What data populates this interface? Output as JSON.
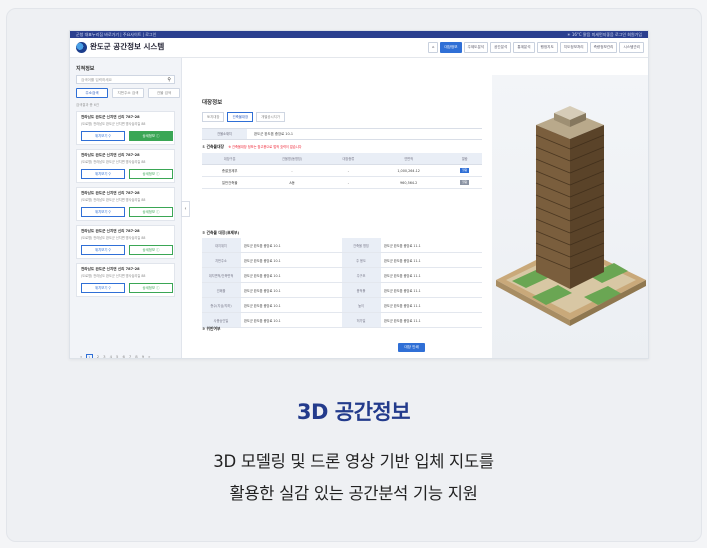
{
  "card": {
    "title": "3D 공간정보",
    "desc_line1": "3D 모델링 및 드론 영상 기반 입체 지도를",
    "desc_line2": "활용한 실감 있는 공간분석 기능 지원",
    "accent": "#233b8c"
  },
  "screenshot": {
    "topbar": {
      "left": "군청 대표누리집 바로가기 | 주요사이트 | 로그인",
      "right": "☀ 16°C  맑음  미세먼지좋음  로그인  회원가입"
    },
    "app_title": "완도군 공간정보 시스템",
    "nav": [
      "",
      "대장정보",
      "주제도분석",
      "공간분석",
      "통계분석",
      "행정지도",
      "지도정보처리",
      "측량정보관리",
      "시스템관리"
    ],
    "sidebar": {
      "title": "지적정보",
      "search_placeholder": "검색어를 입력하세요",
      "tabs": [
        "주소검색",
        "지번주소 검색",
        "건물 검색"
      ],
      "count": "검색결과 총 6건",
      "results": [
        {
          "title": "전라남도 완도군 신지면 신리 787-28",
          "sub": "(도로명) 전라남도 완도군 신지면 명사십리길 88",
          "b1": "위치보기 ⚲",
          "b2": "상세정보 ⓘ"
        },
        {
          "title": "전라남도 완도군 신지면 신리 787-28",
          "sub": "(도로명) 전라남도 완도군 신지면 명사십리길 88",
          "b1": "위치보기 ⚲",
          "b2": "상세정보 ⓘ"
        },
        {
          "title": "전라남도 완도군 신지면 신리 787-28",
          "sub": "(도로명) 전라남도 완도군 신지면 명사십리길 88",
          "b1": "위치보기 ⚲",
          "b2": "상세정보 ⓘ"
        },
        {
          "title": "전라남도 완도군 신지면 신리 787-28",
          "sub": "(도로명) 전라남도 완도군 신지면 명사십리길 88",
          "b1": "위치보기 ⚲",
          "b2": "상세정보 ⓘ"
        },
        {
          "title": "전라남도 완도군 신지면 신리 787-28",
          "sub": "(도로명) 전라남도 완도군 신지면 명사십리길 88",
          "b1": "위치보기 ⚲",
          "b2": "상세정보 ⓘ"
        }
      ],
      "pager": [
        "«",
        "1",
        "2",
        "3",
        "4",
        "5",
        "6",
        "7",
        "8",
        "9",
        "»"
      ]
    },
    "main": {
      "title": "대장정보",
      "tabs": [
        "토지대장",
        "건축물대장",
        "개별공시지가"
      ],
      "addr_key": "건물소재지",
      "addr_val": "완도군 완도읍 중앙로 10-1",
      "sec1": "① 건축물대장",
      "sec1_note": "※ 건축물대장 정보는 참고용으로 법적 효력이 없습니다",
      "table_headers": [
        "대장구분",
        "건물명(동명칭)",
        "대장종류",
        "연면적",
        "열람"
      ],
      "table_rows": [
        [
          "총괄표제부",
          "-",
          "-",
          "1,000,264.12",
          "열람"
        ],
        [
          "일반건축물",
          "A동",
          "-",
          "960,564.2",
          "열람"
        ]
      ],
      "sec2": "② 건축물 대장(표제부)",
      "grid_rows": [
        [
          "대지위치",
          "완도군 완도읍 중앙로 10-1",
          "건축물 명칭",
          "완도군 완도읍 중앙로 11-1"
        ],
        [
          "지번주소",
          "완도군 완도읍 중앙로 10-1",
          "주 용도",
          "완도군 완도읍 중앙로 11-1"
        ],
        [
          "대지면적/건축면적",
          "완도군 완도읍 중앙로 10-1",
          "주구조",
          "완도군 완도읍 중앙로 11-1"
        ],
        [
          "건폐율",
          "완도군 완도읍 중앙로 10-1",
          "용적률",
          "완도군 완도읍 중앙로 11-1"
        ],
        [
          "층수(지상/지하)",
          "완도군 완도읍 중앙로 10-1",
          "높이",
          "완도군 완도읍 중앙로 11-1"
        ],
        [
          "사용승인일",
          "완도군 완도읍 중앙로 10-1",
          "허가일",
          "완도군 완도읍 중앙로 11-1"
        ]
      ],
      "sec3": "③ 위반여부",
      "confirm": "대장 인쇄"
    },
    "colors": {
      "primary": "#2f6fd6",
      "topbar": "#2a3f8f",
      "green": "#3aa655"
    }
  }
}
